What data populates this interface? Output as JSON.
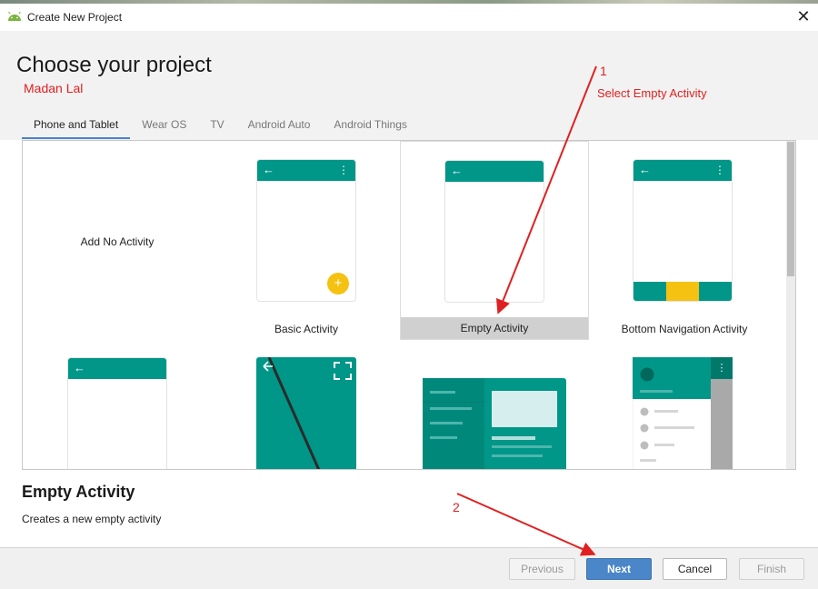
{
  "window": {
    "title": "Create New Project",
    "close_glyph": "✕"
  },
  "page": {
    "title": "Choose your project",
    "author": "Madan Lal"
  },
  "annotations": {
    "step1": "1",
    "step1_text": "Select Empty Activity",
    "step2": "2"
  },
  "tabs": [
    {
      "label": "Phone and Tablet",
      "active": true
    },
    {
      "label": "Wear OS"
    },
    {
      "label": "TV"
    },
    {
      "label": "Android Auto"
    },
    {
      "label": "Android Things"
    }
  ],
  "templates": [
    {
      "label": "Add No Activity"
    },
    {
      "label": "Basic Activity"
    },
    {
      "label": "Empty Activity",
      "selected": true
    },
    {
      "label": "Bottom Navigation Activity"
    }
  ],
  "glyphs": {
    "back": "←",
    "menu": "⋮",
    "fab": "+",
    "fullscreen": "⛶"
  },
  "selection": {
    "title": "Empty Activity",
    "description": "Creates a new empty activity"
  },
  "buttons": {
    "previous": "Previous",
    "next": "Next",
    "cancel": "Cancel",
    "finish": "Finish"
  },
  "colors": {
    "accent": "#009688",
    "fab": "#f5c211",
    "annotation": "#e02020",
    "primary_button": "#4a86c8"
  }
}
